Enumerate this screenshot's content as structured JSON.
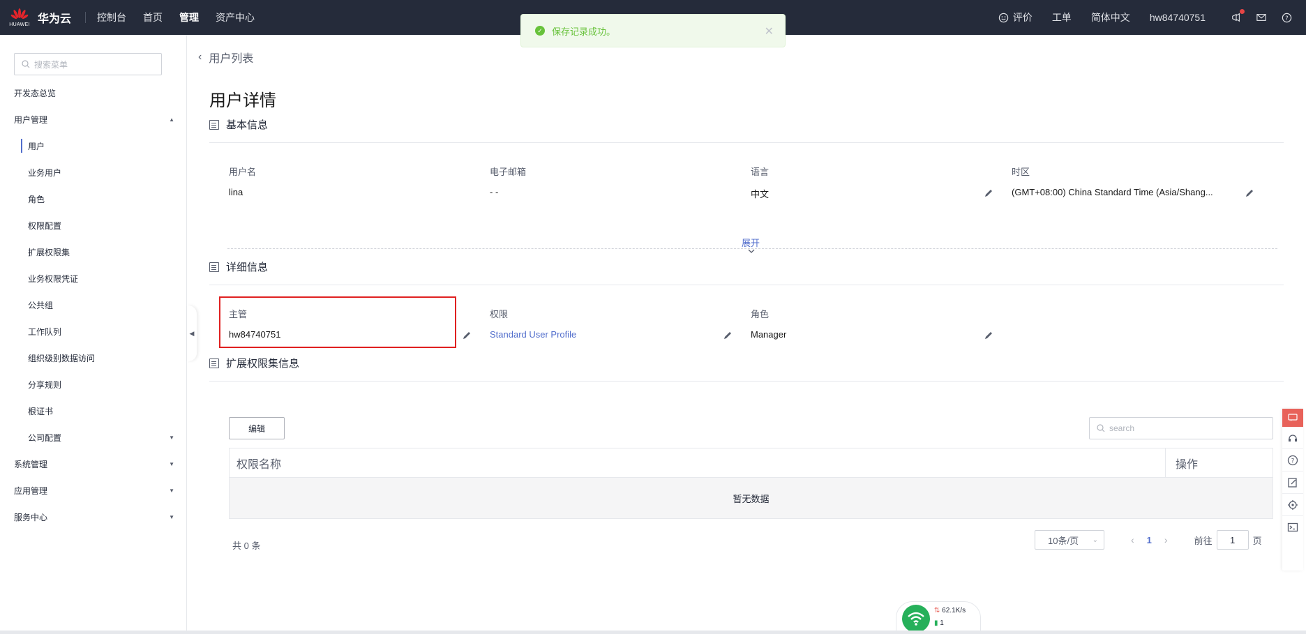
{
  "topbar": {
    "brand_word": "HUAWEI",
    "brand_name": "华为云",
    "nav": [
      "控制台",
      "首页",
      "管理",
      "资产中心"
    ],
    "active_nav": "管理",
    "feedback": "评价",
    "tickets": "工单",
    "language": "简体中文",
    "username": "hw84740751"
  },
  "toast": {
    "message": "保存记录成功。"
  },
  "sidebar": {
    "search_placeholder": "搜索菜单",
    "items": [
      {
        "label": "开发态总览"
      },
      {
        "label": "用户管理"
      },
      {
        "label": "用户"
      },
      {
        "label": "业务用户"
      },
      {
        "label": "角色"
      },
      {
        "label": "权限配置"
      },
      {
        "label": "扩展权限集"
      },
      {
        "label": "业务权限凭证"
      },
      {
        "label": "公共组"
      },
      {
        "label": "工作队列"
      },
      {
        "label": "组织级别数据访问"
      },
      {
        "label": "分享规则"
      },
      {
        "label": "根证书"
      },
      {
        "label": "公司配置"
      },
      {
        "label": "系统管理"
      },
      {
        "label": "应用管理"
      },
      {
        "label": "服务中心"
      }
    ]
  },
  "main": {
    "back_label": "用户列表",
    "title": "用户详情",
    "basic": {
      "title": "基本信息",
      "fields": [
        {
          "label": "用户名",
          "value": "lina"
        },
        {
          "label": "电子邮箱",
          "value": "- -"
        },
        {
          "label": "语言",
          "value": "中文"
        },
        {
          "label": "时区",
          "value": "(GMT+08:00) China Standard Time (Asia/Shang..."
        }
      ],
      "expand": "展开"
    },
    "detail": {
      "title": "详细信息",
      "fields": [
        {
          "label": "主管",
          "value": "hw84740751"
        },
        {
          "label": "权限",
          "value": "Standard User Profile"
        },
        {
          "label": "角色",
          "value": "Manager"
        }
      ]
    },
    "ext": {
      "title": "扩展权限集信息",
      "edit_button": "编辑",
      "search_placeholder": "search",
      "columns": [
        "权限名称",
        "操作"
      ],
      "empty": "暂无数据",
      "total": "共 0 条",
      "page_size": "10条/页",
      "current_page": "1",
      "goto_label": "前往",
      "goto_value": "1",
      "page_suffix": "页"
    }
  },
  "net_widget": {
    "speed": "62.1K/s",
    "count": "1"
  },
  "colors": {
    "topbar": "#252b3a",
    "accent": "#526ecc",
    "success": "#67c23a",
    "highlight": "#e02020"
  }
}
